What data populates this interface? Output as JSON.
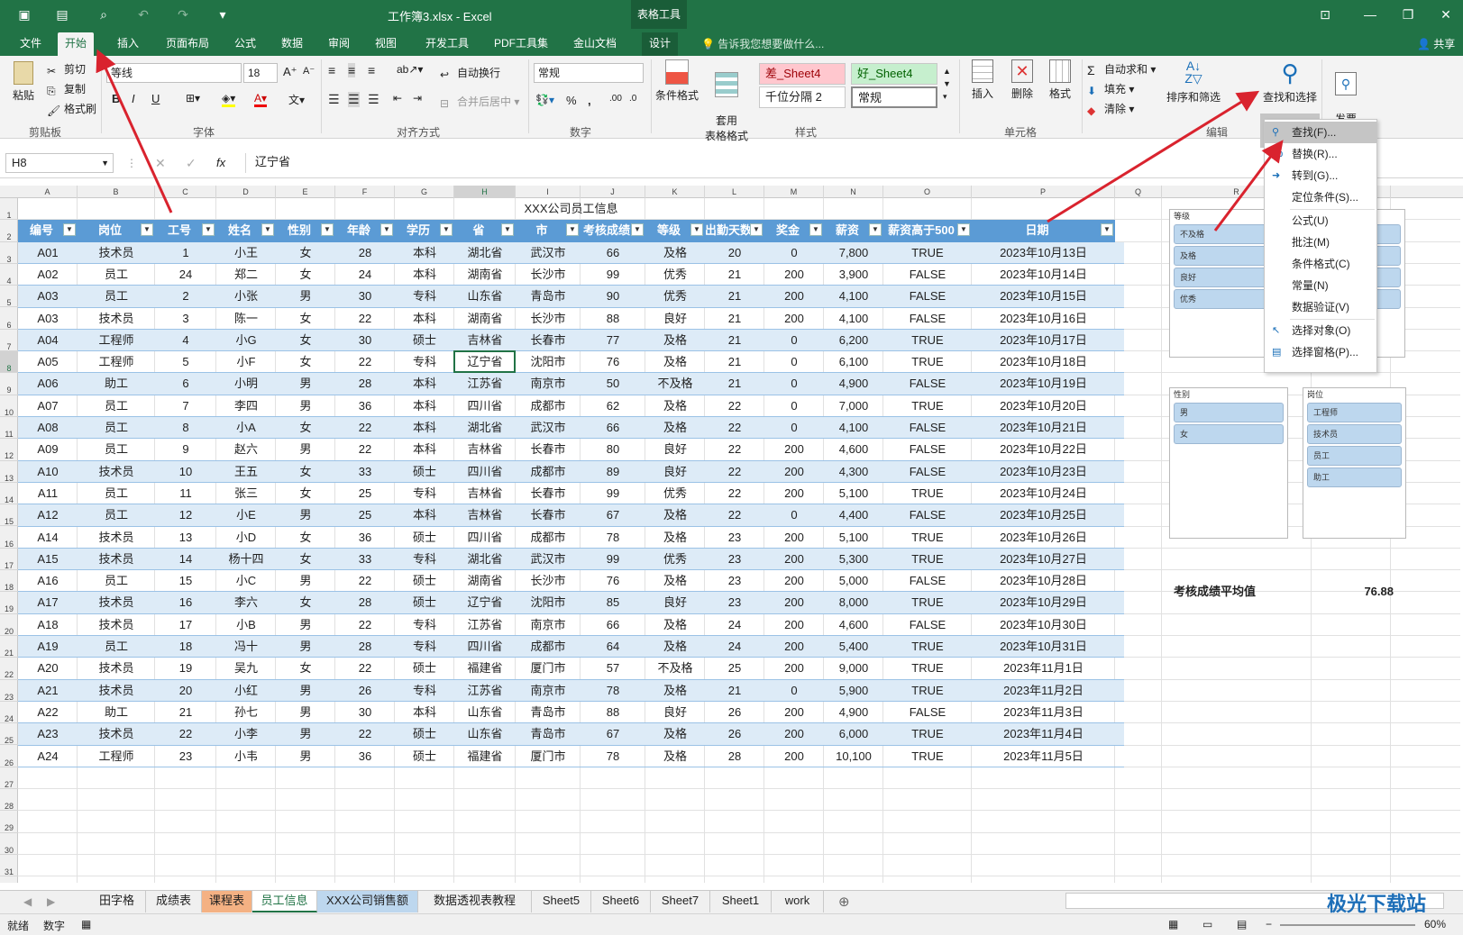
{
  "window": {
    "title": "工作簿3.xlsx - Excel",
    "context_tab": "表格工具"
  },
  "tabs": [
    "文件",
    "开始",
    "插入",
    "页面布局",
    "公式",
    "数据",
    "审阅",
    "视图",
    "开发工具",
    "PDF工具集",
    "金山文档",
    "设计"
  ],
  "active_tab": "开始",
  "tell_me": "告诉我您想要做什么...",
  "share": "共享",
  "ribbon": {
    "clipboard": {
      "paste": "粘贴",
      "cut": "剪切",
      "copy": "复制",
      "format_painter": "格式刷",
      "label": "剪贴板"
    },
    "font": {
      "name": "等线",
      "size": "18",
      "bold": "B",
      "italic": "I",
      "underline": "U",
      "label": "字体"
    },
    "alignment": {
      "wrap": "自动换行",
      "merge": "合并后居中",
      "label": "对齐方式"
    },
    "number": {
      "format": "常规",
      "percent": "%",
      "comma": ",",
      "label": "数字"
    },
    "styles": {
      "conditional": "条件格式",
      "table_format": "套用\n表格格式",
      "bad": "差_Sheet4",
      "good": "好_Sheet4",
      "thousands": "千位分隔 2",
      "normal": "常规",
      "label": "样式"
    },
    "cells": {
      "insert": "插入",
      "delete": "删除",
      "format": "格式",
      "label": "单元格"
    },
    "editing": {
      "autosum": "自动求和",
      "fill": "填充",
      "clear": "清除",
      "sort": "排序和筛选",
      "find": "查找和选择",
      "label": "编辑"
    },
    "invoice": "发票\n查验"
  },
  "formula_bar": {
    "name_box": "H8",
    "fx": "fx",
    "formula": "辽宁省"
  },
  "columns": [
    "A",
    "B",
    "C",
    "D",
    "E",
    "F",
    "G",
    "H",
    "I",
    "J",
    "K",
    "L",
    "M",
    "N",
    "O",
    "P",
    "Q",
    "R",
    "S"
  ],
  "sheet_title": "XXX公司员工信息",
  "table": {
    "headers": [
      "编号",
      "岗位",
      "工号",
      "姓名",
      "性别",
      "年龄",
      "学历",
      "省",
      "市",
      "考核成绩",
      "等级",
      "出勤天数",
      "奖金",
      "薪资",
      "薪资高于500",
      "日期"
    ],
    "rows": [
      [
        "A01",
        "技术员",
        "1",
        "小王",
        "女",
        "28",
        "本科",
        "湖北省",
        "武汉市",
        "66",
        "及格",
        "20",
        "0",
        "7,800",
        "TRUE",
        "2023年10月13日"
      ],
      [
        "A02",
        "员工",
        "24",
        "郑二",
        "女",
        "24",
        "本科",
        "湖南省",
        "长沙市",
        "99",
        "优秀",
        "21",
        "200",
        "3,900",
        "FALSE",
        "2023年10月14日"
      ],
      [
        "A03",
        "员工",
        "2",
        "小张",
        "男",
        "30",
        "专科",
        "山东省",
        "青岛市",
        "90",
        "优秀",
        "21",
        "200",
        "4,100",
        "FALSE",
        "2023年10月15日"
      ],
      [
        "A03",
        "技术员",
        "3",
        "陈一",
        "女",
        "22",
        "本科",
        "湖南省",
        "长沙市",
        "88",
        "良好",
        "21",
        "200",
        "4,100",
        "FALSE",
        "2023年10月16日"
      ],
      [
        "A04",
        "工程师",
        "4",
        "小G",
        "女",
        "30",
        "硕士",
        "吉林省",
        "长春市",
        "77",
        "及格",
        "21",
        "0",
        "6,200",
        "TRUE",
        "2023年10月17日"
      ],
      [
        "A05",
        "工程师",
        "5",
        "小F",
        "女",
        "22",
        "专科",
        "辽宁省",
        "沈阳市",
        "76",
        "及格",
        "21",
        "0",
        "6,100",
        "TRUE",
        "2023年10月18日"
      ],
      [
        "A06",
        "助工",
        "6",
        "小明",
        "男",
        "28",
        "本科",
        "江苏省",
        "南京市",
        "50",
        "不及格",
        "21",
        "0",
        "4,900",
        "FALSE",
        "2023年10月19日"
      ],
      [
        "A07",
        "员工",
        "7",
        "李四",
        "男",
        "36",
        "本科",
        "四川省",
        "成都市",
        "62",
        "及格",
        "22",
        "0",
        "7,000",
        "TRUE",
        "2023年10月20日"
      ],
      [
        "A08",
        "员工",
        "8",
        "小A",
        "女",
        "22",
        "本科",
        "湖北省",
        "武汉市",
        "66",
        "及格",
        "22",
        "0",
        "4,100",
        "FALSE",
        "2023年10月21日"
      ],
      [
        "A09",
        "员工",
        "9",
        "赵六",
        "男",
        "22",
        "本科",
        "吉林省",
        "长春市",
        "80",
        "良好",
        "22",
        "200",
        "4,600",
        "FALSE",
        "2023年10月22日"
      ],
      [
        "A10",
        "技术员",
        "10",
        "王五",
        "女",
        "33",
        "硕士",
        "四川省",
        "成都市",
        "89",
        "良好",
        "22",
        "200",
        "4,300",
        "FALSE",
        "2023年10月23日"
      ],
      [
        "A11",
        "员工",
        "11",
        "张三",
        "女",
        "25",
        "专科",
        "吉林省",
        "长春市",
        "99",
        "优秀",
        "22",
        "200",
        "5,100",
        "TRUE",
        "2023年10月24日"
      ],
      [
        "A12",
        "员工",
        "12",
        "小E",
        "男",
        "25",
        "本科",
        "吉林省",
        "长春市",
        "67",
        "及格",
        "22",
        "0",
        "4,400",
        "FALSE",
        "2023年10月25日"
      ],
      [
        "A14",
        "技术员",
        "13",
        "小D",
        "女",
        "36",
        "硕士",
        "四川省",
        "成都市",
        "78",
        "及格",
        "23",
        "200",
        "5,100",
        "TRUE",
        "2023年10月26日"
      ],
      [
        "A15",
        "技术员",
        "14",
        "杨十四",
        "女",
        "33",
        "专科",
        "湖北省",
        "武汉市",
        "99",
        "优秀",
        "23",
        "200",
        "5,300",
        "TRUE",
        "2023年10月27日"
      ],
      [
        "A16",
        "员工",
        "15",
        "小C",
        "男",
        "22",
        "硕士",
        "湖南省",
        "长沙市",
        "76",
        "及格",
        "23",
        "200",
        "5,000",
        "FALSE",
        "2023年10月28日"
      ],
      [
        "A17",
        "技术员",
        "16",
        "李六",
        "女",
        "28",
        "硕士",
        "辽宁省",
        "沈阳市",
        "85",
        "良好",
        "23",
        "200",
        "8,000",
        "TRUE",
        "2023年10月29日"
      ],
      [
        "A18",
        "技术员",
        "17",
        "小B",
        "男",
        "22",
        "专科",
        "江苏省",
        "南京市",
        "66",
        "及格",
        "24",
        "200",
        "4,600",
        "FALSE",
        "2023年10月30日"
      ],
      [
        "A19",
        "员工",
        "18",
        "冯十",
        "男",
        "28",
        "专科",
        "四川省",
        "成都市",
        "64",
        "及格",
        "24",
        "200",
        "5,400",
        "TRUE",
        "2023年10月31日"
      ],
      [
        "A20",
        "技术员",
        "19",
        "吴九",
        "女",
        "22",
        "硕士",
        "福建省",
        "厦门市",
        "57",
        "不及格",
        "25",
        "200",
        "9,000",
        "TRUE",
        "2023年11月1日"
      ],
      [
        "A21",
        "技术员",
        "20",
        "小红",
        "男",
        "26",
        "专科",
        "江苏省",
        "南京市",
        "78",
        "及格",
        "21",
        "0",
        "5,900",
        "TRUE",
        "2023年11月2日"
      ],
      [
        "A22",
        "助工",
        "21",
        "孙七",
        "男",
        "30",
        "本科",
        "山东省",
        "青岛市",
        "88",
        "良好",
        "26",
        "200",
        "4,900",
        "FALSE",
        "2023年11月3日"
      ],
      [
        "A23",
        "技术员",
        "22",
        "小李",
        "男",
        "22",
        "硕士",
        "山东省",
        "青岛市",
        "67",
        "及格",
        "26",
        "200",
        "6,000",
        "TRUE",
        "2023年11月4日"
      ],
      [
        "A24",
        "工程师",
        "23",
        "小韦",
        "男",
        "36",
        "硕士",
        "福建省",
        "厦门市",
        "78",
        "及格",
        "28",
        "200",
        "10,100",
        "TRUE",
        "2023年11月5日"
      ]
    ]
  },
  "slicers": {
    "grade": {
      "title": "等级",
      "items": [
        "不及格",
        "及格",
        "良好",
        "优秀"
      ]
    },
    "gender": {
      "title": "性别",
      "items": [
        "男",
        "女"
      ]
    },
    "position": {
      "title": "岗位",
      "items": [
        "工程师",
        "技术员",
        "员工",
        "助工"
      ]
    }
  },
  "summary": {
    "label": "考核成绩平均值",
    "value": "76.88"
  },
  "find_menu": [
    "查找(F)...",
    "替换(R)...",
    "转到(G)...",
    "定位条件(S)...",
    "公式(U)",
    "批注(M)",
    "条件格式(C)",
    "常量(N)",
    "数据验证(V)",
    "选择对象(O)",
    "选择窗格(P)..."
  ],
  "sheet_tabs": [
    "田字格",
    "成绩表",
    "课程表",
    "员工信息",
    "XXX公司销售额",
    "数据透视表教程",
    "Sheet5",
    "Sheet6",
    "Sheet7",
    "Sheet1",
    "work"
  ],
  "active_sheet": "员工信息",
  "status": {
    "ready": "就绪",
    "mode": "数字",
    "zoom": "60%"
  },
  "watermark": "极光下载站",
  "colors": {
    "excel_green": "#217346",
    "table_header": "#5b9bd5",
    "band": "#ddebf7",
    "slicer_item": "#bdd7ee",
    "arrow": "#d9232e"
  }
}
